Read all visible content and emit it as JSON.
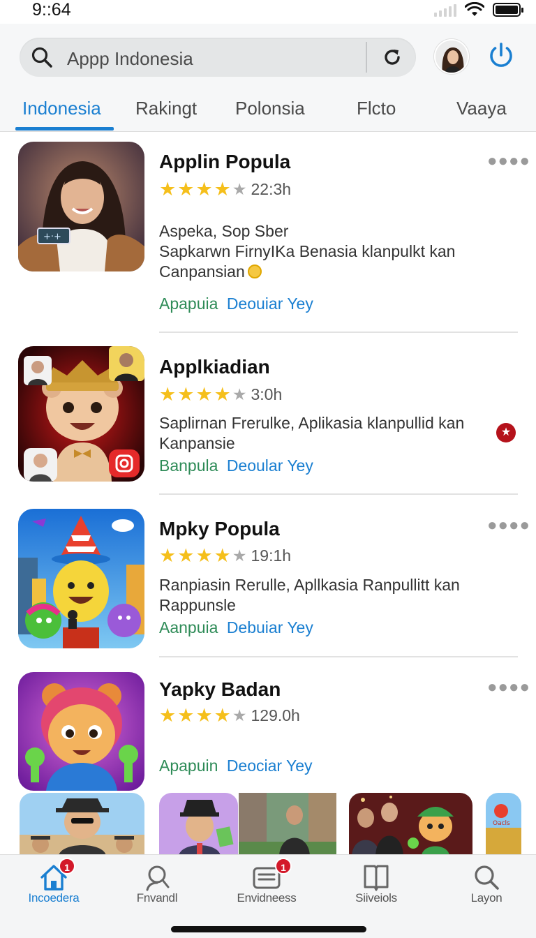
{
  "status_bar": {
    "time": "9::64"
  },
  "search": {
    "text": "Appp Indonesia"
  },
  "tabs": [
    {
      "label": "Indonesia",
      "active": true
    },
    {
      "label": "Rakingt",
      "active": false
    },
    {
      "label": "Polonsia",
      "active": false
    },
    {
      "label": "Flcto",
      "active": false
    },
    {
      "label": "Vaaya",
      "active": false
    }
  ],
  "apps": [
    {
      "title": "Applin Popula",
      "rating": 4,
      "rating_text": "22:3h",
      "desc_line1": "Aspeka, Sop Sber",
      "desc_line2": "Sapkarwn FirnyIKa Benasia klanpulkt kan",
      "desc_line3": "Canpansian",
      "link_a": "Apapuia",
      "link_b": "Deouiar Yey"
    },
    {
      "title": "Applkiadian",
      "rating": 4,
      "rating_text": "3:0h",
      "desc_line1": "Saplirnan Frerulke, Aplikasia klanpullid kan",
      "desc_line2": "Kanpansie",
      "link_a": "Banpula",
      "link_b": "Deoular Yey"
    },
    {
      "title": "Mpky Popula",
      "rating": 4,
      "rating_text": "19:1h",
      "desc_line1": "Ranpiasin Rerulle, Apllkasia Ranpullitt kan",
      "desc_line2": "Rappunsle",
      "link_a": "Aanpuia",
      "link_b": "Debuiar Yey"
    },
    {
      "title": "Yapky Badan",
      "rating": 4,
      "rating_text": "129.0h",
      "link_a": "Apapuin",
      "link_b": "Deociar Yey"
    }
  ],
  "bottom_nav": [
    {
      "label": "Incoedera",
      "icon": "home-icon",
      "badge": "1",
      "active": true
    },
    {
      "label": "Fnvandl",
      "icon": "person-search-icon",
      "active": false
    },
    {
      "label": "Envidneess",
      "icon": "inbox-icon",
      "badge": "1",
      "active": false
    },
    {
      "label": "Siiveiols",
      "icon": "book-icon",
      "active": false
    },
    {
      "label": "Layon",
      "icon": "search-icon",
      "active": false
    }
  ],
  "colors": {
    "accent": "#1a7fd1",
    "star": "#f5bf1b",
    "link_green": "#2e8b57",
    "badge_red": "#d3192a"
  }
}
